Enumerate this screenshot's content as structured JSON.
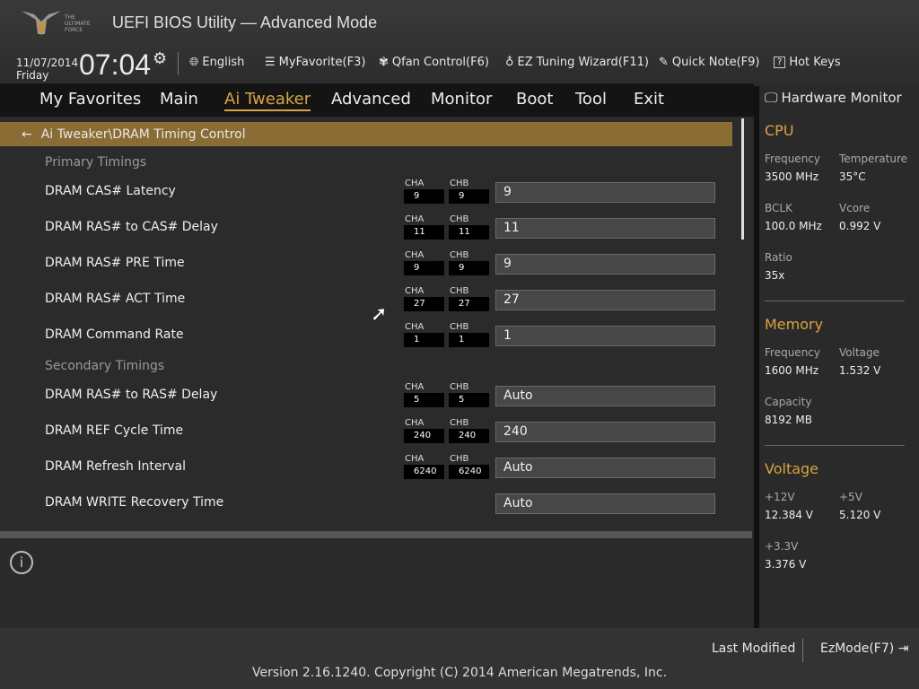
{
  "header": {
    "logo_text": "THE ULTIMATE FORCE",
    "title": "UEFI BIOS Utility — Advanced Mode",
    "date": "11/07/2014",
    "day": "Friday",
    "time": "07:04",
    "tools": [
      {
        "icon": "globe-icon",
        "label": "English"
      },
      {
        "icon": "favorite-list-icon",
        "label": "MyFavorite(F3)"
      },
      {
        "icon": "fan-icon",
        "label": "Qfan Control(F6)"
      },
      {
        "icon": "bulb-icon",
        "label": "EZ Tuning Wizard(F11)"
      },
      {
        "icon": "note-icon",
        "label": "Quick Note(F9)"
      },
      {
        "icon": "question-icon",
        "label": "Hot Keys"
      }
    ]
  },
  "nav": {
    "tabs": [
      "My Favorites",
      "Main",
      "Ai Tweaker",
      "Advanced",
      "Monitor",
      "Boot",
      "Tool",
      "Exit"
    ],
    "active": "Ai Tweaker"
  },
  "breadcrumb": "Ai Tweaker\\DRAM Timing Control",
  "sections": {
    "primary": "Primary Timings",
    "secondary": "Secondary Timings"
  },
  "channel_labels": {
    "a": "CHA",
    "b": "CHB"
  },
  "rows": [
    {
      "label": "DRAM CAS# Latency",
      "cha": "9",
      "chb": "9",
      "value": "9"
    },
    {
      "label": "DRAM RAS# to CAS# Delay",
      "cha": "11",
      "chb": "11",
      "value": "11"
    },
    {
      "label": "DRAM RAS# PRE Time",
      "cha": "9",
      "chb": "9",
      "value": "9"
    },
    {
      "label": "DRAM RAS# ACT Time",
      "cha": "27",
      "chb": "27",
      "value": "27"
    },
    {
      "label": "DRAM Command Rate",
      "cha": "1",
      "chb": "1",
      "value": "1"
    },
    {
      "label": "DRAM RAS# to RAS# Delay",
      "cha": "5",
      "chb": "5",
      "value": "Auto"
    },
    {
      "label": "DRAM REF Cycle Time",
      "cha": "240",
      "chb": "240",
      "value": "240"
    },
    {
      "label": "DRAM Refresh Interval",
      "cha": "6240",
      "chb": "6240",
      "value": "Auto"
    },
    {
      "label": "DRAM WRITE Recovery Time",
      "value": "Auto"
    }
  ],
  "hw": {
    "title": "Hardware Monitor",
    "cpu": {
      "title": "CPU",
      "frequency_label": "Frequency",
      "frequency": "3500 MHz",
      "temp_label": "Temperature",
      "temp": "35°C",
      "bclk_label": "BCLK",
      "bclk": "100.0 MHz",
      "vcore_label": "Vcore",
      "vcore": "0.992 V",
      "ratio_label": "Ratio",
      "ratio": "35x"
    },
    "memory": {
      "title": "Memory",
      "frequency_label": "Frequency",
      "frequency": "1600 MHz",
      "voltage_label": "Voltage",
      "voltage": "1.532 V",
      "capacity_label": "Capacity",
      "capacity": "8192 MB"
    },
    "voltage": {
      "title": "Voltage",
      "v12_label": "+12V",
      "v12": "12.384 V",
      "v5_label": "+5V",
      "v5": "5.120 V",
      "v33_label": "+3.3V",
      "v33": "3.376 V"
    }
  },
  "footer": {
    "last_modified": "Last Modified",
    "ezmode": "EzMode(F7)",
    "copyright": "Version 2.16.1240. Copyright (C) 2014 American Megatrends, Inc."
  },
  "colors": {
    "accent": "#d9a441",
    "breadcrumb": "#8a6c35"
  }
}
